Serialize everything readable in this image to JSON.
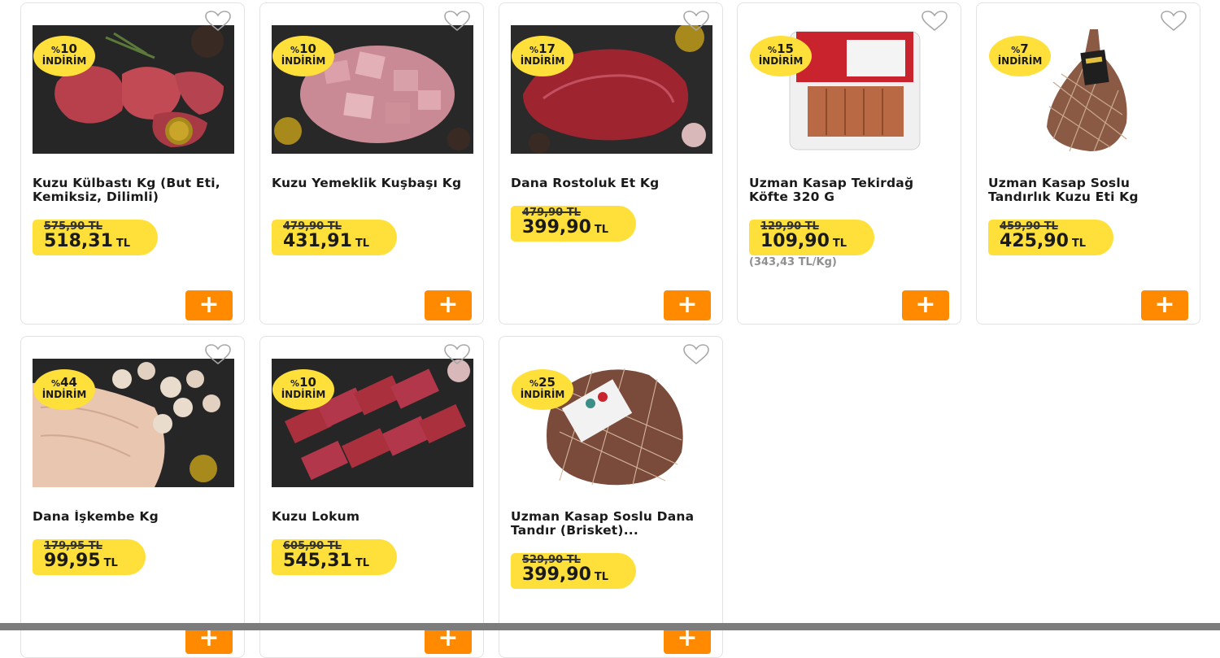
{
  "products": [
    {
      "discount_pct": "10",
      "percent_sign": "%",
      "badge_label": "İNDİRİM",
      "title": "Kuzu Külbastı Kg (But Eti, Kemiksiz, Dilimli)",
      "old_price": "575,90 TL",
      "price": "518,31",
      "currency": "TL",
      "unit_price": "",
      "image": "lamb-steak-image",
      "add_label": "+"
    },
    {
      "discount_pct": "10",
      "percent_sign": "%",
      "badge_label": "İNDİRİM",
      "title": "Kuzu Yemeklik Kuşbaşı Kg",
      "old_price": "479,90 TL",
      "price": "431,91",
      "currency": "TL",
      "unit_price": "",
      "image": "lamb-cubes-image",
      "add_label": "+"
    },
    {
      "discount_pct": "17",
      "percent_sign": "%",
      "badge_label": "İNDİRİM",
      "title": "Dana Rostoluk Et Kg",
      "old_price": "479,90 TL",
      "price": "399,90",
      "currency": "TL",
      "unit_price": "",
      "image": "beef-roast-image",
      "add_label": "+"
    },
    {
      "discount_pct": "15",
      "percent_sign": "%",
      "badge_label": "İNDİRİM",
      "title": "Uzman Kasap Tekirdağ Köfte 320 G",
      "old_price": "129,90 TL",
      "price": "109,90",
      "currency": "TL",
      "unit_price": "(343,43 TL/Kg)",
      "image": "kofte-pack-image",
      "add_label": "+"
    },
    {
      "discount_pct": "7",
      "percent_sign": "%",
      "badge_label": "İNDİRİM",
      "title": "Uzman Kasap Soslu Tandırlık Kuzu Eti Kg",
      "old_price": "459,90 TL",
      "price": "425,90",
      "currency": "TL",
      "unit_price": "",
      "image": "lamb-net-image",
      "add_label": "+"
    },
    {
      "discount_pct": "44",
      "percent_sign": "%",
      "badge_label": "İNDİRİM",
      "title": "Dana İşkembe Kg",
      "old_price": "179,95 TL",
      "price": "99,95",
      "currency": "TL",
      "unit_price": "",
      "image": "tripe-image",
      "add_label": "+"
    },
    {
      "discount_pct": "10",
      "percent_sign": "%",
      "badge_label": "İNDİRİM",
      "title": "Kuzu Lokum",
      "old_price": "605,90 TL",
      "price": "545,31",
      "currency": "TL",
      "unit_price": "",
      "image": "lamb-slices-image",
      "add_label": "+"
    },
    {
      "discount_pct": "25",
      "percent_sign": "%",
      "badge_label": "İNDİRİM",
      "title": "Uzman Kasap Soslu Dana Tandır (Brisket)...",
      "old_price": "529,90 TL",
      "price": "399,90",
      "currency": "TL",
      "unit_price": "",
      "image": "brisket-net-image",
      "add_label": "+"
    }
  ],
  "colors": {
    "badge": "#ffe03a",
    "add_button": "#ff8a00",
    "card_border": "#e3e3e3",
    "unit_price_text": "#8f8f8f"
  },
  "icons": {
    "favorite": "heart-outline-icon",
    "add": "plus-icon"
  }
}
